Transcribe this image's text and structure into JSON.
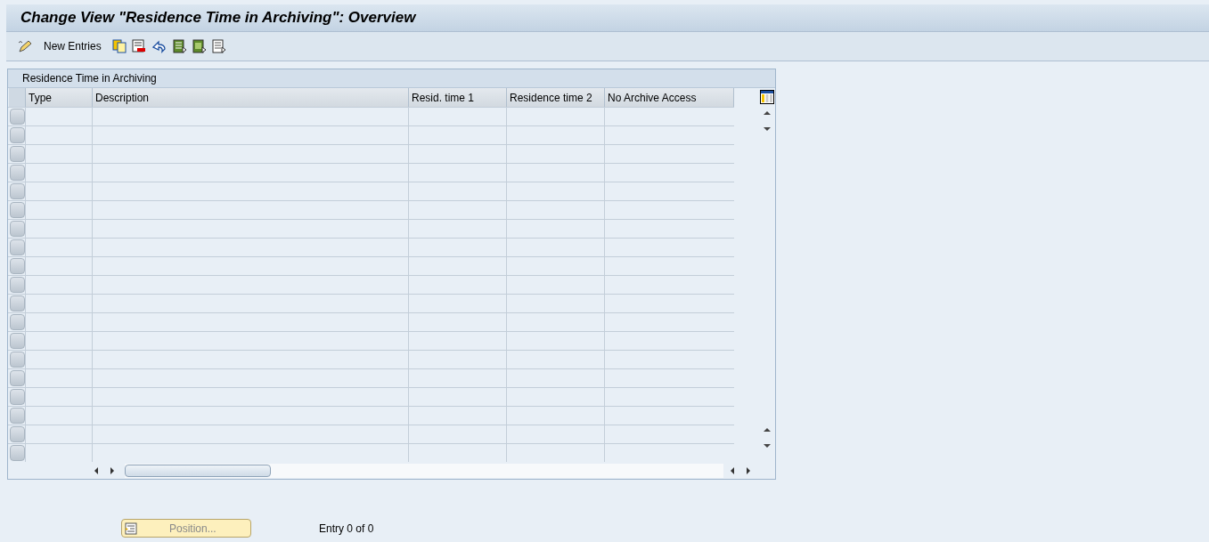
{
  "window": {
    "title": "Change View \"Residence Time in Archiving\": Overview"
  },
  "toolbar": {
    "items": [
      {
        "kind": "icon"
      },
      {
        "kind": "text",
        "label": "New Entries"
      },
      {
        "kind": "icon"
      },
      {
        "kind": "icon"
      },
      {
        "kind": "icon"
      },
      {
        "kind": "icon"
      },
      {
        "kind": "icon"
      },
      {
        "kind": "icon"
      }
    ]
  },
  "table": {
    "title": "Residence Time in Archiving",
    "columns": [
      "Type",
      "Description",
      "Resid. time 1",
      "Residence time 2",
      "No Archive Access"
    ]
  },
  "footer": {
    "position_button": {
      "label": "Position...",
      "disabled": true
    },
    "entry_count": "Entry 0 of 0"
  }
}
